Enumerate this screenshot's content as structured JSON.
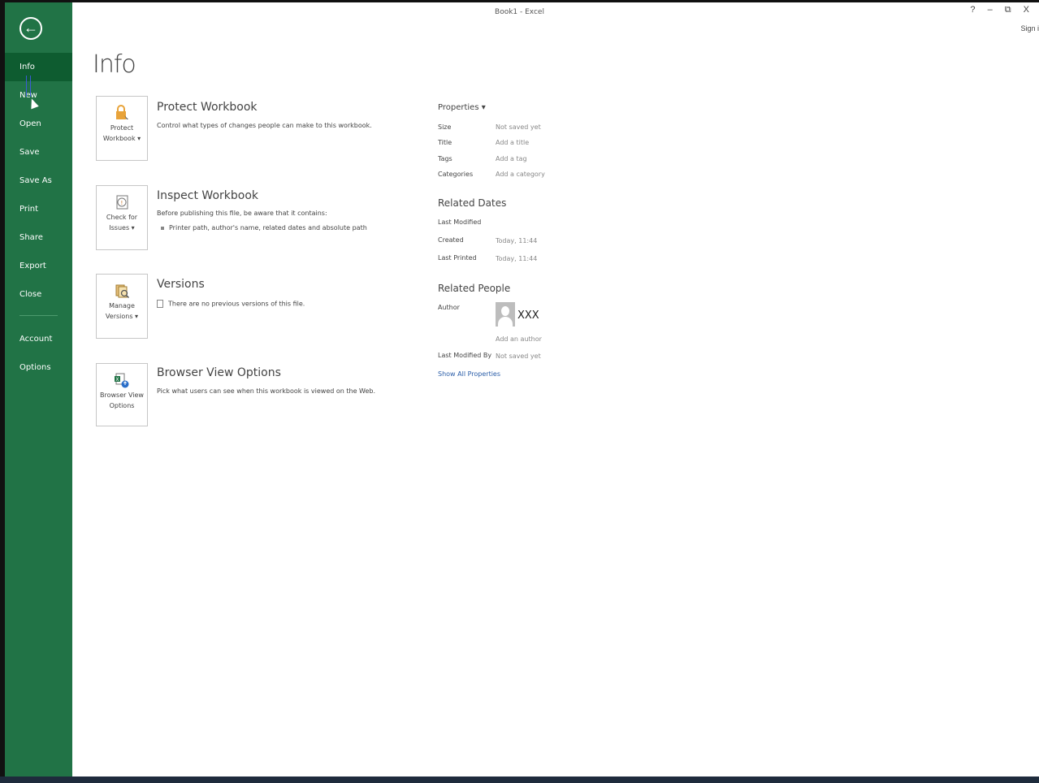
{
  "window": {
    "title": "Book1 - Excel",
    "controls": "? – ⧉ X",
    "sign_in": "Sign i"
  },
  "sidebar": {
    "back_glyph": "←",
    "items": [
      {
        "label": "Info",
        "active": true
      },
      {
        "label": "New"
      },
      {
        "label": "Open"
      },
      {
        "label": "Save"
      },
      {
        "label": "Save As"
      },
      {
        "label": "Print"
      },
      {
        "label": "Share"
      },
      {
        "label": "Export"
      },
      {
        "label": "Close"
      }
    ],
    "bottom_items": [
      {
        "label": "Account"
      },
      {
        "label": "Options"
      }
    ]
  },
  "main": {
    "page_title": "Info",
    "sections": [
      {
        "tile_label_1": "Protect",
        "tile_label_2": "Workbook ▾",
        "title": "Protect Workbook",
        "desc": "Control what types of changes people can make to this workbook.",
        "icon": "lock-icon"
      },
      {
        "tile_label_1": "Check for",
        "tile_label_2": "Issues ▾",
        "title": "Inspect Workbook",
        "desc": "Before publishing this file, be aware that it contains:",
        "bullet": "Printer path, author's name, related dates and absolute path",
        "icon": "inspect-icon"
      },
      {
        "tile_label_1": "Manage",
        "tile_label_2": "Versions ▾",
        "title": "Versions",
        "desc": "There are no previous versions of this file.",
        "icon": "versions-icon"
      },
      {
        "tile_label_1": "Browser View",
        "tile_label_2": "Options",
        "title": "Browser View Options",
        "desc": "Pick what users can see when this workbook is viewed on the Web.",
        "icon": "browser-view-icon"
      }
    ]
  },
  "properties": {
    "title": "Properties ▾",
    "rows": [
      {
        "label": "Size",
        "value": "Not saved yet"
      },
      {
        "label": "Title",
        "value": "Add a title"
      },
      {
        "label": "Tags",
        "value": "Add a tag"
      },
      {
        "label": "Categories",
        "value": "Add a category"
      }
    ],
    "related_dates_title": "Related Dates",
    "dates": [
      {
        "label": "Last Modified",
        "value": ""
      },
      {
        "label": "Created",
        "value": "Today, 11:44"
      },
      {
        "label": "Last Printed",
        "value": "Today, 11:44"
      }
    ],
    "related_people_title": "Related People",
    "author_label": "Author",
    "author_name": "XXX",
    "add_author": "Add an author",
    "last_modified_by_label": "Last Modified By",
    "last_modified_by_value": "Not saved yet",
    "show_all": "Show All Properties"
  },
  "colors": {
    "accent": "#217346",
    "active": "#0e5c30"
  }
}
